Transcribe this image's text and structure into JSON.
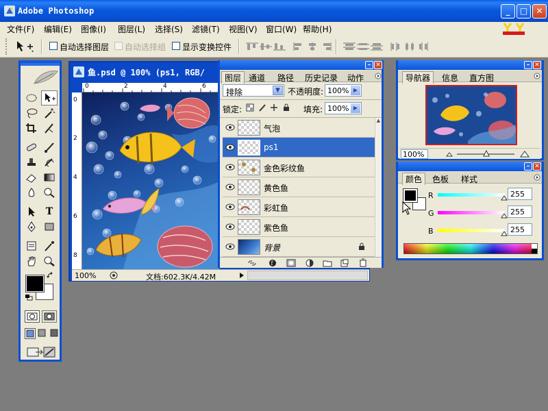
{
  "window": {
    "title": "Adobe Photoshop",
    "minimize": "_",
    "maximize": "□",
    "close": "✕"
  },
  "menu": [
    "文件(F)",
    "编辑(E)",
    "图像(I)",
    "图层(L)",
    "选择(S)",
    "滤镜(T)",
    "视图(V)",
    "窗口(W)",
    "帮助(H)"
  ],
  "options": {
    "auto_select_layer": "自动选择图层",
    "auto_select_group": "自动选择组",
    "show_transform": "显示变换控件",
    "tool_icon": "move-tool-icon"
  },
  "document": {
    "title": "鱼.psd @ 100% (ps1, RGB/",
    "zoom": "100%",
    "doc_info": "文档:602.3K/4.42M",
    "ruler_top": [
      "0",
      "2",
      "4",
      "6"
    ],
    "ruler_left": [
      "0",
      "2",
      "4",
      "6",
      "8"
    ]
  },
  "layers_panel": {
    "tabs": [
      "图层",
      "通道",
      "路径",
      "历史记录",
      "动作"
    ],
    "blend_mode": "排除",
    "opacity_label": "不透明度:",
    "opacity": "100%",
    "lock_label": "锁定:",
    "fill_label": "填充:",
    "fill": "100%",
    "layers": [
      {
        "name": "气泡",
        "selected": false
      },
      {
        "name": "ps1",
        "selected": true
      },
      {
        "name": "金色彩纹鱼",
        "selected": false
      },
      {
        "name": "黄色鱼",
        "selected": false
      },
      {
        "name": "彩虹鱼",
        "selected": false
      },
      {
        "name": "紫色鱼",
        "selected": false
      },
      {
        "name": "背景",
        "selected": false
      }
    ]
  },
  "navigator_panel": {
    "tabs": [
      "导航器",
      "信息",
      "直方图"
    ],
    "zoom": "100%"
  },
  "color_panel": {
    "tabs": [
      "颜色",
      "色板",
      "样式"
    ],
    "r_label": "R",
    "g_label": "G",
    "b_label": "B",
    "r": "255",
    "g": "255",
    "b": "255",
    "foreground": "#000000",
    "background": "#ffffff"
  },
  "colors": {
    "title_blue": "#0a58dc",
    "panel_bg": "#ece9d8",
    "workspace": "#7d7d7d",
    "selection": "#3169c6"
  }
}
